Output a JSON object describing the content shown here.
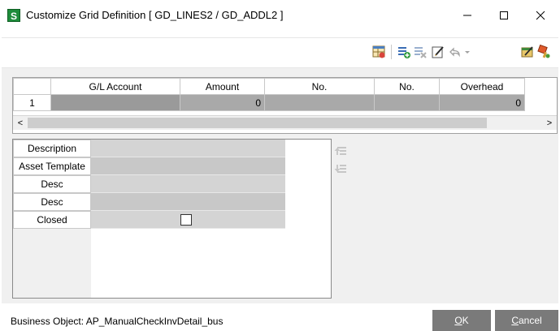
{
  "window": {
    "app_icon_glyph": "S",
    "title": "Customize Grid Definition [ GD_LINES2 / GD_ADDL2 ]",
    "min_label": "—",
    "max_label": "☐",
    "close_label": "✕"
  },
  "toolbar": {
    "icons": [
      "grid-layout-icon",
      "add-column-icon",
      "delete-column-icon",
      "edit-icon",
      "undo-icon",
      "dropdown-arrow-icon",
      "customize-icon",
      "paint-icon"
    ]
  },
  "grid": {
    "columns": [
      "",
      "G/L Account",
      "Amount",
      "No.",
      "No.",
      "Overhead",
      ""
    ],
    "rows": [
      {
        "row_number": "1",
        "cells": [
          "",
          "0",
          "",
          "",
          "0",
          ""
        ]
      }
    ],
    "scroll_left": "<",
    "scroll_right": ">"
  },
  "properties": {
    "rows": [
      {
        "label": "Description",
        "value": ""
      },
      {
        "label": "Asset Template",
        "value": ""
      },
      {
        "label": "Desc",
        "value": ""
      },
      {
        "label": "Desc",
        "value": ""
      },
      {
        "label": "Closed",
        "checkbox": true,
        "checked": false
      }
    ]
  },
  "footer": {
    "business_object": "Business Object: AP_ManualCheckInvDetail_bus",
    "ok_accel": "O",
    "ok_rest": "K",
    "cancel_accel": "C",
    "cancel_rest": "ancel"
  },
  "colors": {
    "accent_button": "#7a7a7a",
    "grid_cell": "#a9a9a9",
    "app_icon": "#1e8c3a"
  }
}
